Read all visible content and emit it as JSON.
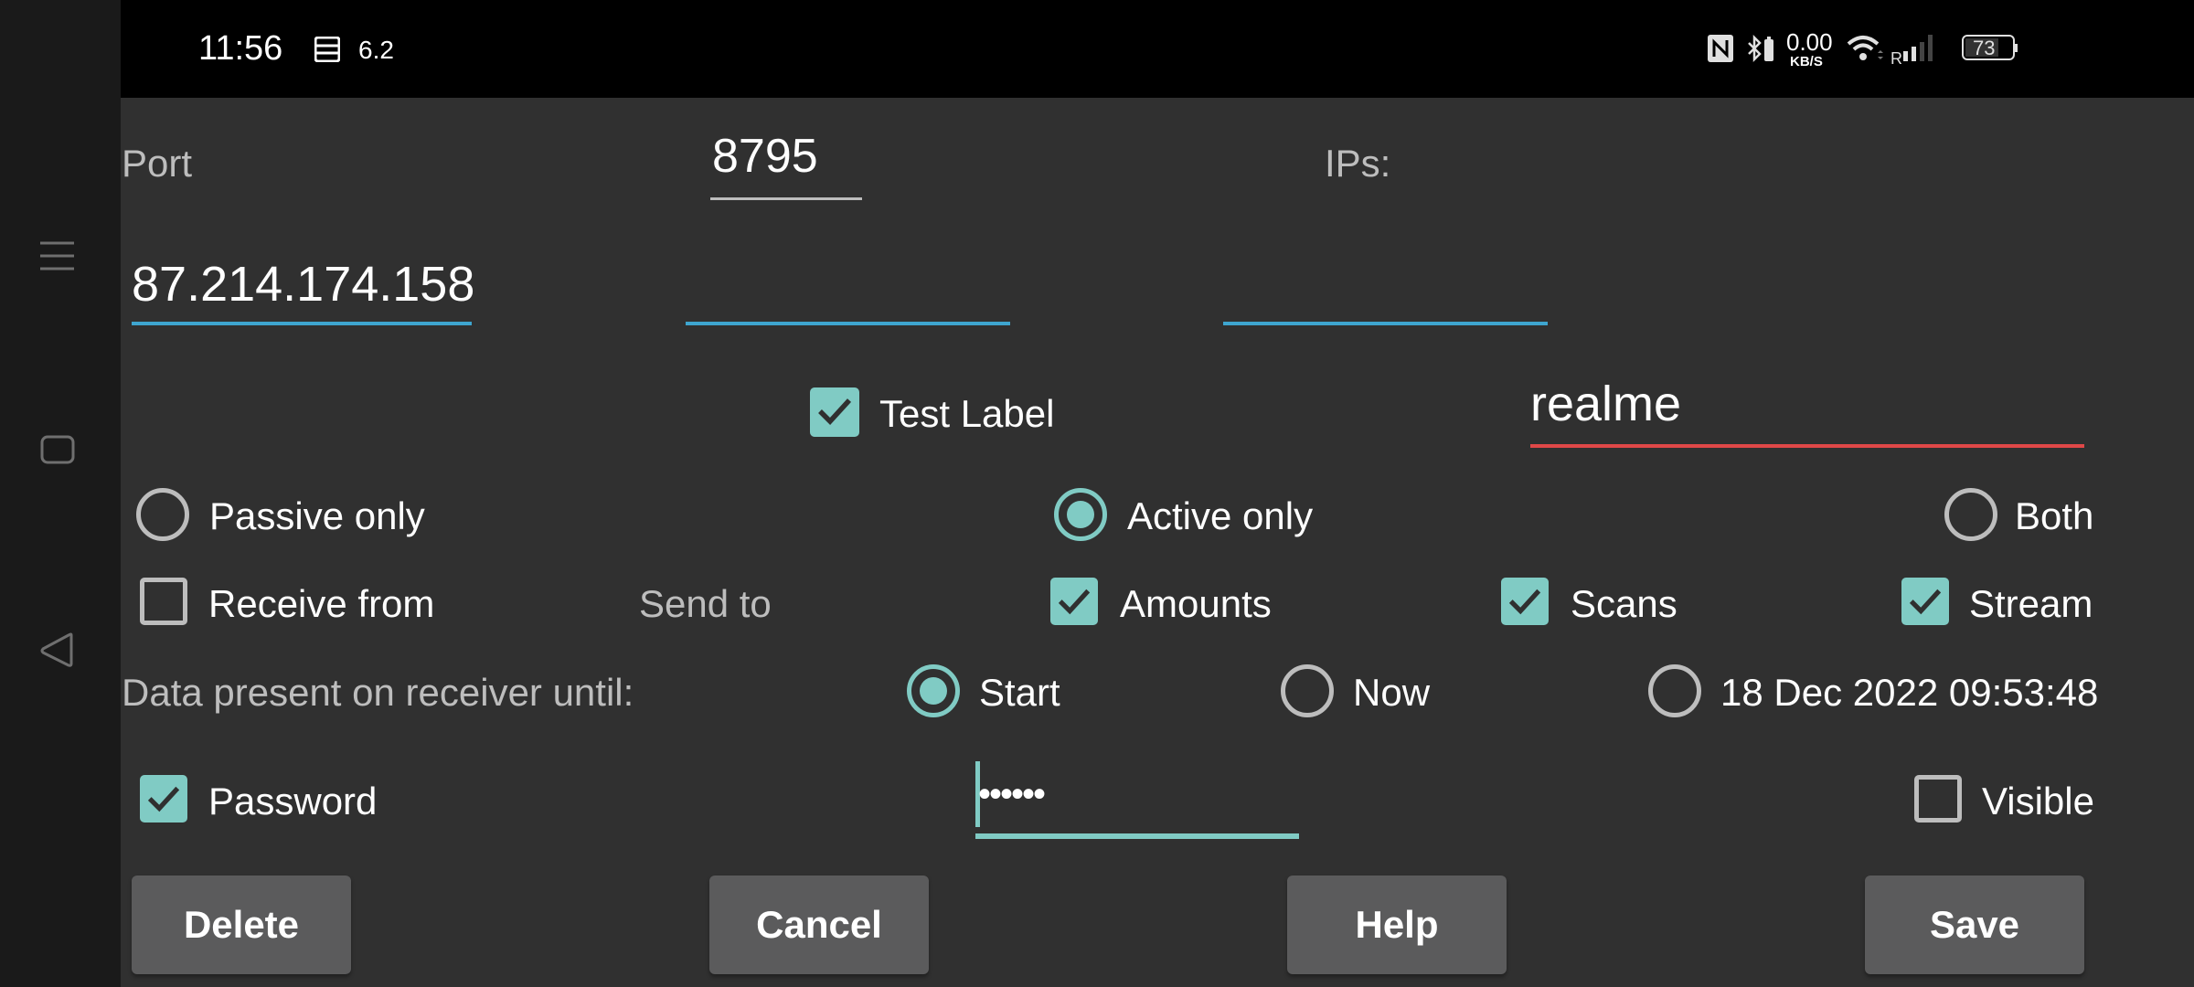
{
  "status_bar": {
    "time": "11:56",
    "notification_icon": "sim-card-icon",
    "notification_text": "6.2",
    "nfc_icon": "nfc-icon",
    "bluetooth_icon": "bluetooth-battery-icon",
    "net_speed_value": "0.00",
    "net_speed_unit": "KB/S",
    "wifi_icon": "wifi-icon",
    "roaming_label": "R",
    "signal_icon": "signal-icon",
    "battery_level": "73"
  },
  "nav_bar": {
    "menu_icon": "menu-icon",
    "home_icon": "home-icon",
    "back_icon": "back-icon"
  },
  "form": {
    "port_label": "Port",
    "port_value": "8795",
    "ips_label": "IPs:",
    "ip_fields": [
      "87.214.174.158",
      "",
      ""
    ],
    "test_label": {
      "label": "Test Label",
      "checked": true
    },
    "name_value": "realme",
    "mode_options": [
      {
        "label": "Passive only",
        "selected": false
      },
      {
        "label": "Active only",
        "selected": true
      },
      {
        "label": "Both",
        "selected": false
      }
    ],
    "receive_from": {
      "label": "Receive from",
      "checked": false
    },
    "send_to_label": "Send to",
    "send_to_options": [
      {
        "label": "Amounts",
        "checked": true
      },
      {
        "label": "Scans",
        "checked": true
      },
      {
        "label": "Stream",
        "checked": true
      }
    ],
    "data_present_label": "Data present on receiver until:",
    "data_until_options": [
      {
        "label": "Start",
        "selected": true
      },
      {
        "label": "Now",
        "selected": false
      },
      {
        "label": "18 Dec 2022 09:53:48",
        "selected": false
      }
    ],
    "password": {
      "label": "Password",
      "checked": true
    },
    "password_value": "••••••",
    "visible": {
      "label": "Visible",
      "checked": false
    }
  },
  "buttons": {
    "delete": "Delete",
    "cancel": "Cancel",
    "help": "Help",
    "save": "Save"
  },
  "colors": {
    "accent": "#80cbc4",
    "ip_underline": "#3ea5cf",
    "error_underline": "#e04848",
    "background": "#303030",
    "button": "#5b5b5c"
  }
}
